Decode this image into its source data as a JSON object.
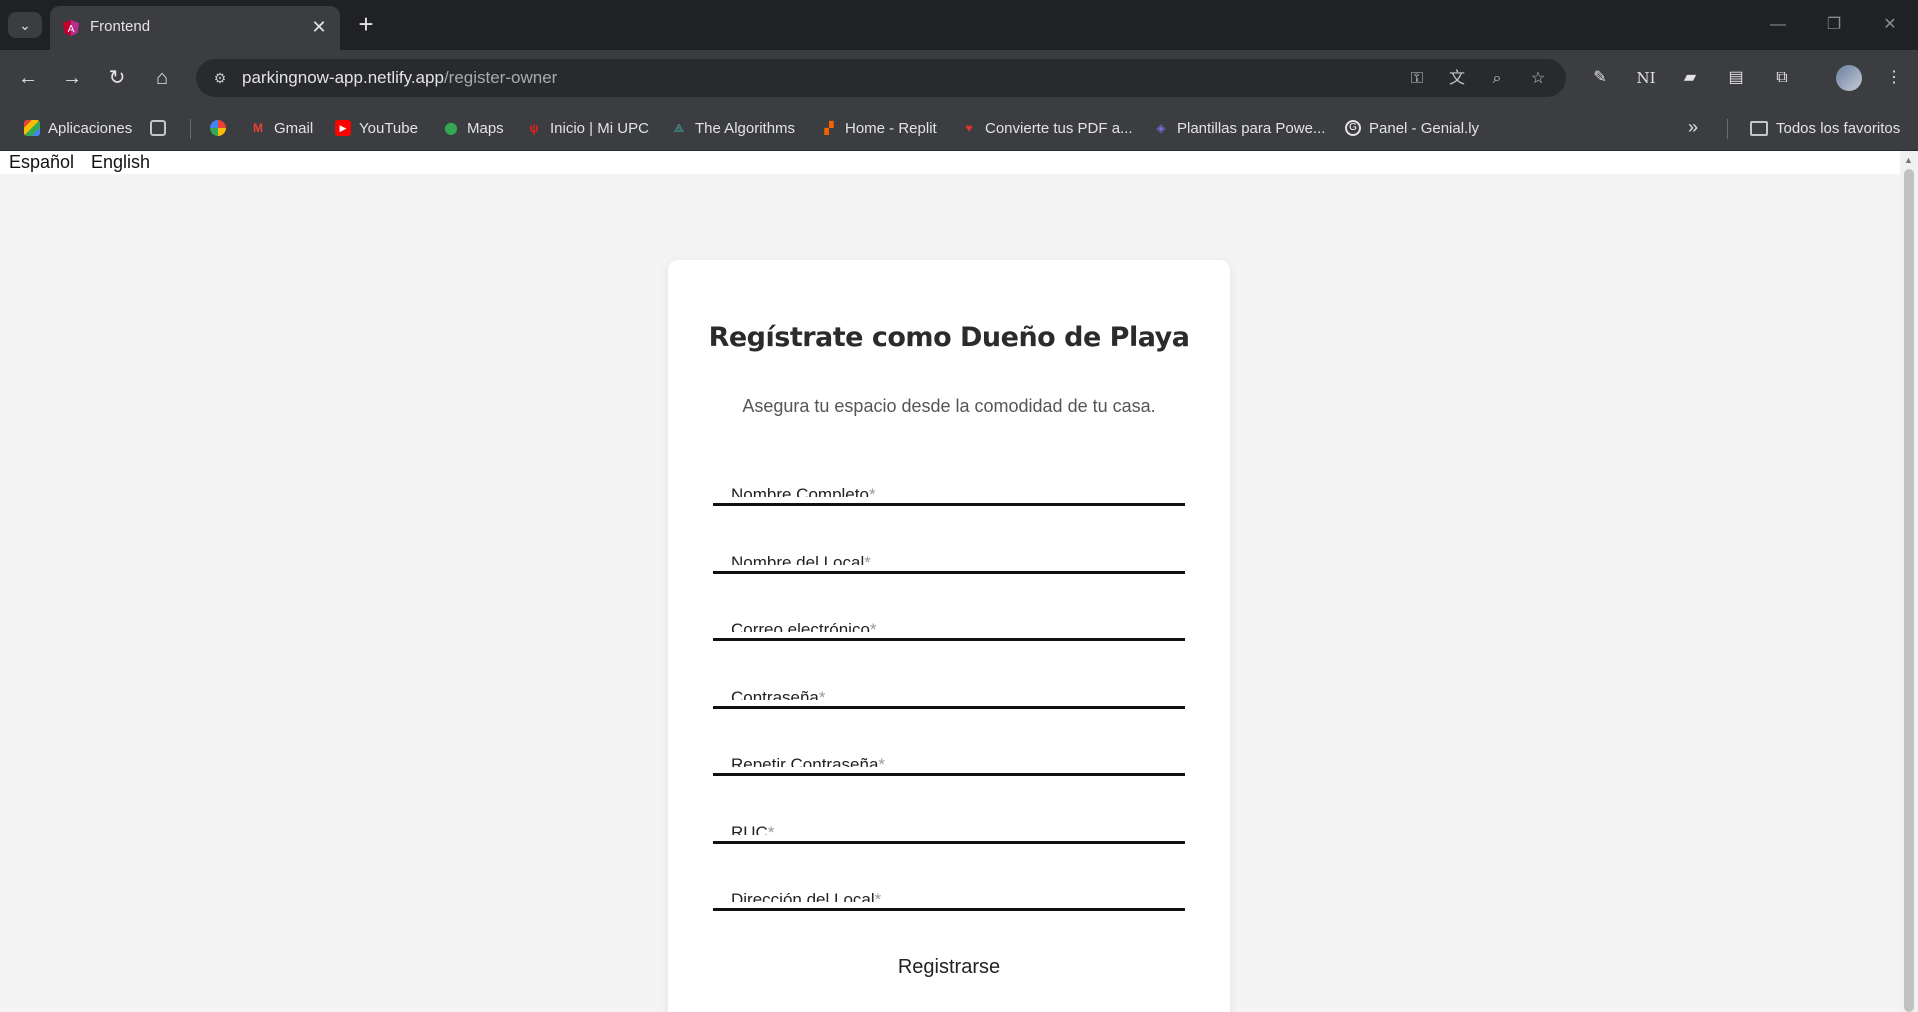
{
  "browser": {
    "tab_title": "Frontend",
    "url_domain": "parkingnow-app.netlify.app",
    "url_path": "/register-owner",
    "bookmarks": [
      {
        "label": "Aplicaciones",
        "icon": "apps-grid-icon"
      },
      {
        "label": "Gmail",
        "icon": "gmail-icon"
      },
      {
        "label": "YouTube",
        "icon": "youtube-icon"
      },
      {
        "label": "Maps",
        "icon": "maps-icon"
      },
      {
        "label": "Inicio | Mi UPC",
        "icon": "upc-icon"
      },
      {
        "label": "The Algorithms",
        "icon": "algorithms-icon"
      },
      {
        "label": "Home - Replit",
        "icon": "replit-icon"
      },
      {
        "label": "Convierte tus PDF a...",
        "icon": "heart-icon"
      },
      {
        "label": "Plantillas para Powe...",
        "icon": "slides-icon"
      },
      {
        "label": "Panel - Genial.ly",
        "icon": "google-icon"
      }
    ],
    "all_bookmarks": "Todos los favoritos"
  },
  "page": {
    "languages": [
      "Español",
      "English"
    ],
    "title": "Regístrate como Dueño de Playa",
    "subtitle": "Asegura tu espacio desde la comodidad de tu casa.",
    "fields": [
      "Nombre Completo",
      "Nombre del Local",
      "Correo electrónico",
      "Contraseña",
      "Repetir Contraseña",
      "RUC",
      "Dirección del Local"
    ],
    "submit_label": "Registrarse"
  }
}
